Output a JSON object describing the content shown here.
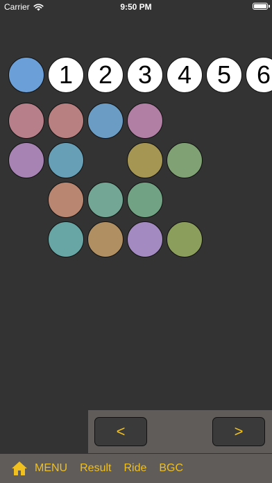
{
  "status_bar": {
    "carrier": "Carrier",
    "time": "9:50 PM",
    "battery_level": 1.0
  },
  "board": {
    "selected_color": "#6a9fd8",
    "number_row": [
      "1",
      "2",
      "3",
      "4",
      "5",
      "6"
    ],
    "grid": [
      [
        "#b67f8a",
        "#b88080",
        "#6a9cc4",
        "#b27fa4",
        null
      ],
      [
        "#a783b4",
        "#67a0b6",
        null,
        "#a69654",
        "#7fa174"
      ],
      [
        null,
        "#b98672",
        "#73a694",
        "#72a284",
        null
      ],
      [
        null,
        "#67a6a4",
        "#b08f62",
        "#a38ac0",
        "#8c9e5c"
      ]
    ]
  },
  "nav": {
    "prev_label": "<",
    "next_label": ">"
  },
  "toolbar": {
    "menu": "MENU",
    "result": "Result",
    "ride": "Ride",
    "bgc": "BGC"
  },
  "colors": {
    "background": "#333333",
    "panel": "#5f5c5a",
    "accent": "#f0c020"
  },
  "icons": {
    "status": [
      "wifi-icon",
      "battery-icon"
    ],
    "toolbar": [
      "home-icon"
    ]
  }
}
